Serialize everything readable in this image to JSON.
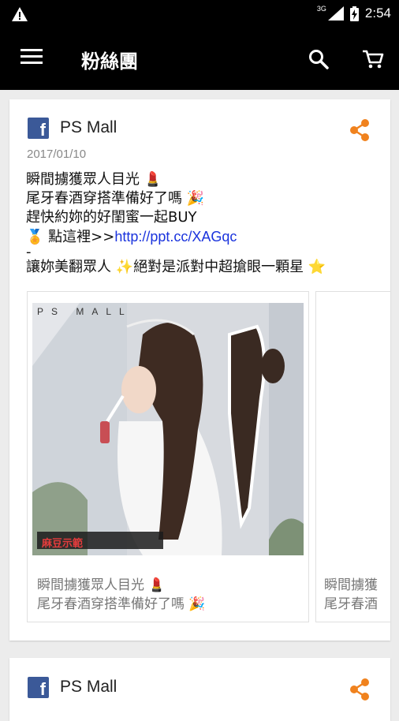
{
  "status_bar": {
    "network": "3G",
    "time": "2:54"
  },
  "app_bar": {
    "title": "粉絲團"
  },
  "posts": [
    {
      "page_name": "PS Mall",
      "date": "2017/01/10",
      "lines": [
        "瞬間擄獲眾人目光 💄",
        "尾牙春酒穿搭準備好了嗎 🎉",
        "趕快約妳的好閨蜜一起BUY",
        "🏅 點這裡>>"
      ],
      "link": "http://ppt.cc/XAGqc",
      "dash": "-",
      "last_line": "讓妳美翻眾人 ✨絕對是派對中超搶眼一顆星 ⭐",
      "photo_brand": "PS MALL",
      "photo_stamp": "麻豆示範",
      "slides": [
        {
          "caption_1": "瞬間擄獲眾人目光 💄",
          "caption_2": "尾牙春酒穿搭準備好了嗎 🎉"
        },
        {
          "caption_1": "瞬間擄獲",
          "caption_2": "尾牙春酒"
        }
      ]
    },
    {
      "page_name": "PS Mall"
    }
  ],
  "colors": {
    "accent": "#f0821e",
    "facebook": "#3b5998",
    "link": "#1a33dd"
  }
}
